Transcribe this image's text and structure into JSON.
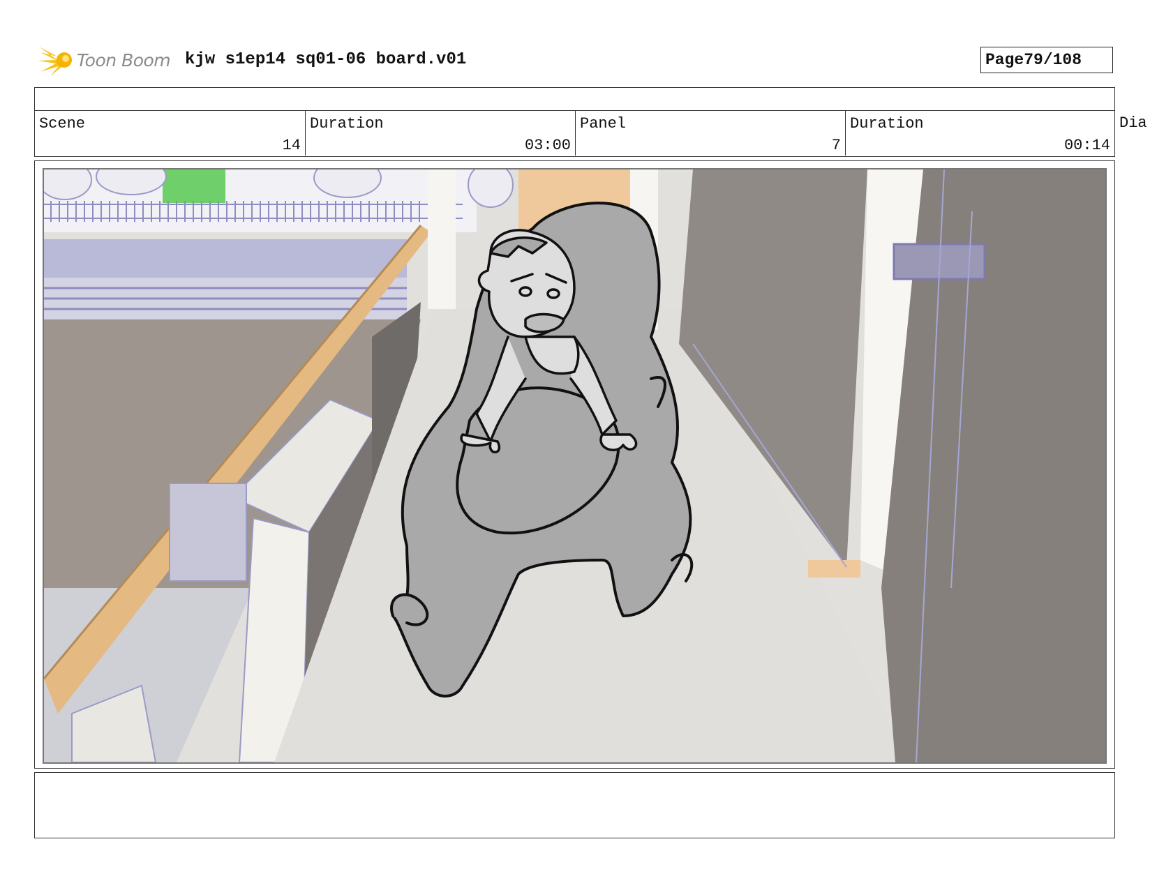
{
  "header": {
    "logo_text": "Toon Boom",
    "document_title": "kjw s1ep14 sq01-06 board.v01",
    "page_label": "Page",
    "page_value": "79/108"
  },
  "info": {
    "scene_label": "Scene",
    "scene_value": "14",
    "scene_duration_label": "Duration",
    "scene_duration_value": "03:00",
    "panel_label": "Panel",
    "panel_value": "7",
    "panel_duration_label": "Duration",
    "panel_duration_value": "00:14",
    "dialogue_label_partial": "Dia"
  },
  "panel": {
    "icons": [
      "toon-boom-logo-icon"
    ],
    "colors": {
      "wall_dark": "#8f8b86",
      "floor": "#dedcd8",
      "wood": "#e9c89b",
      "wire_overlay": "#a9a9d6",
      "creature": "#a9a9a9",
      "lineart": "#111111"
    }
  },
  "caption": {
    "text": ""
  }
}
